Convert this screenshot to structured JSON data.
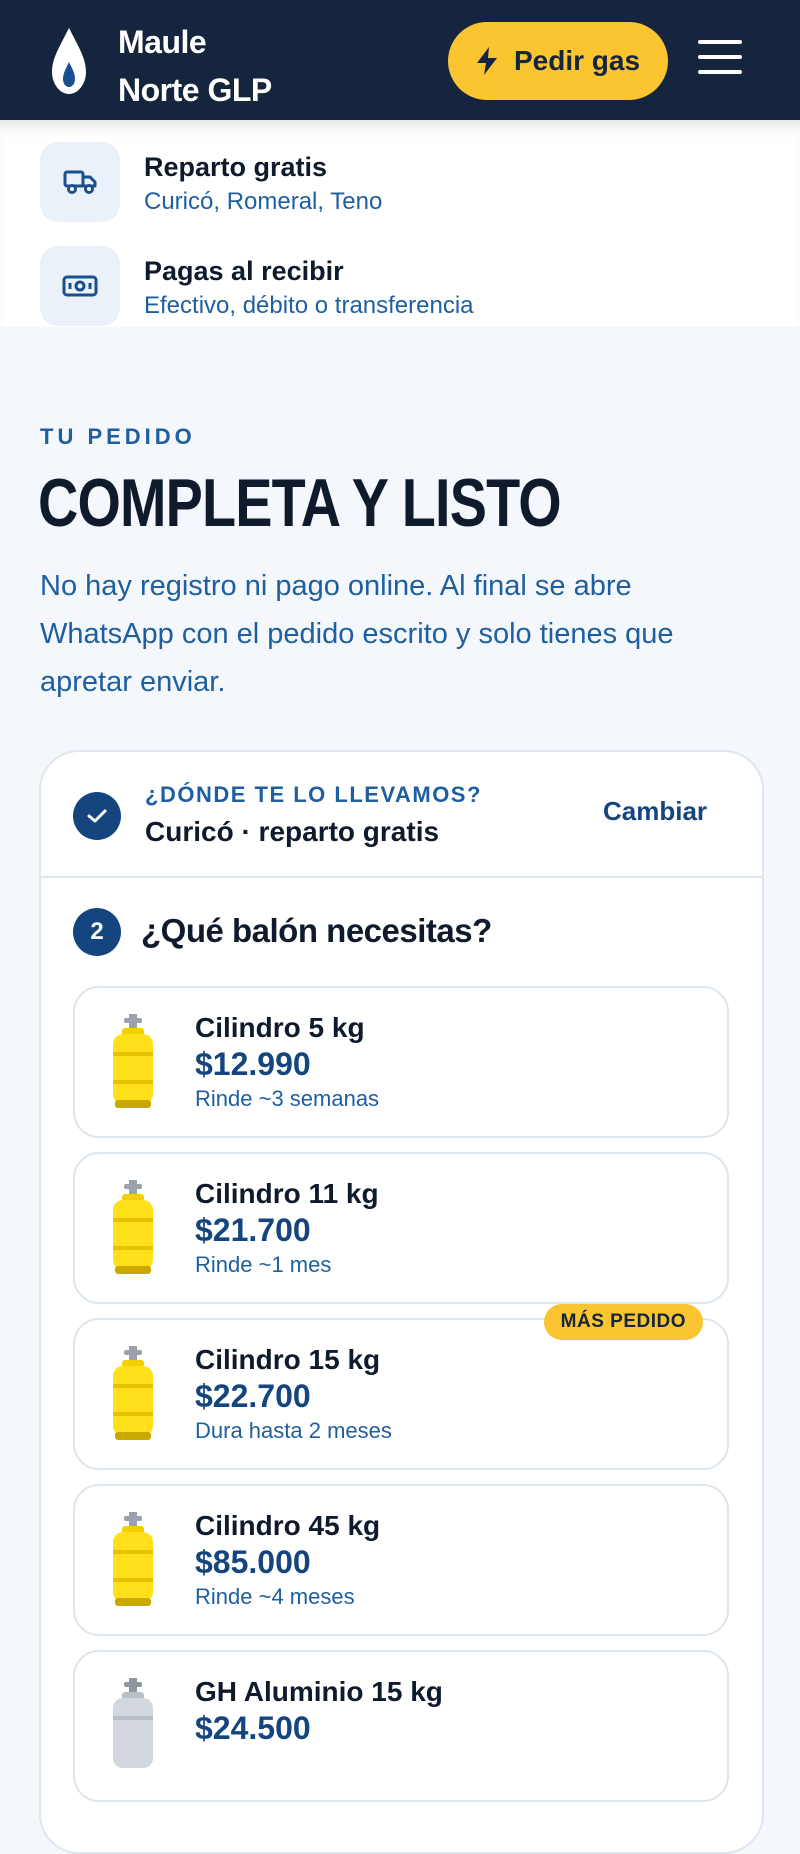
{
  "header": {
    "brand_line1": "Maule",
    "brand_line2": "Norte GLP",
    "cta_label": "Pedir gas"
  },
  "features": [
    {
      "title": "Reparto gratis",
      "subtitle": "Curicó, Romeral, Teno",
      "icon": "truck-icon"
    },
    {
      "title": "Pagas al recibir",
      "subtitle": "Efectivo, débito o transferencia",
      "icon": "banknote-icon"
    }
  ],
  "section": {
    "eyebrow": "TU PEDIDO",
    "title": "COMPLETA Y LISTO",
    "intro": "No hay registro ni pago online. Al final se abre WhatsApp con el pedido escrito y solo tienes que apretar enviar."
  },
  "step1": {
    "label": "¿DÓNDE TE LO LLEVAMOS?",
    "value": "Curicó · reparto gratis",
    "change_label": "Cambiar"
  },
  "step2": {
    "number": "2",
    "title": "¿Qué balón necesitas?",
    "products": [
      {
        "name": "Cilindro 5 kg",
        "price": "$12.990",
        "note": "Rinde ~3 semanas",
        "badge": ""
      },
      {
        "name": "Cilindro 11 kg",
        "price": "$21.700",
        "note": "Rinde ~1 mes",
        "badge": ""
      },
      {
        "name": "Cilindro 15 kg",
        "price": "$22.700",
        "note": "Dura hasta 2 meses",
        "badge": "MÁS PEDIDO"
      },
      {
        "name": "Cilindro 45 kg",
        "price": "$85.000",
        "note": "Rinde ~4 meses",
        "badge": ""
      },
      {
        "name": "GH Aluminio 15 kg",
        "price": "$24.500",
        "note": "",
        "badge": ""
      }
    ]
  },
  "colors": {
    "navy": "#14253d",
    "accent_yellow": "#fbc531",
    "link_blue": "#1f5fa0",
    "dark_blue": "#14457f"
  }
}
